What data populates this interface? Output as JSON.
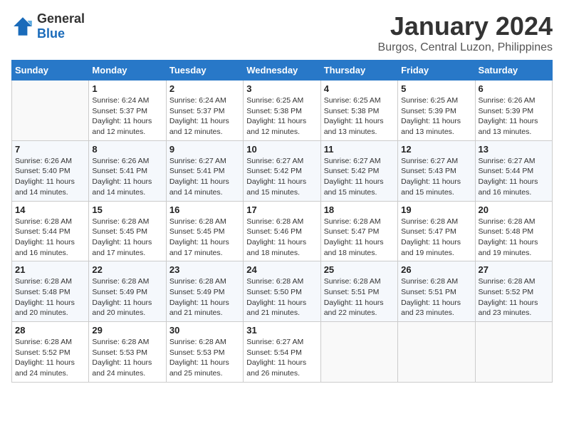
{
  "header": {
    "logo": {
      "general": "General",
      "blue": "Blue"
    },
    "title": "January 2024",
    "location": "Burgos, Central Luzon, Philippines"
  },
  "days_of_week": [
    "Sunday",
    "Monday",
    "Tuesday",
    "Wednesday",
    "Thursday",
    "Friday",
    "Saturday"
  ],
  "weeks": [
    [
      {
        "day": "",
        "info": ""
      },
      {
        "day": "1",
        "info": "Sunrise: 6:24 AM\nSunset: 5:37 PM\nDaylight: 11 hours\nand 12 minutes."
      },
      {
        "day": "2",
        "info": "Sunrise: 6:24 AM\nSunset: 5:37 PM\nDaylight: 11 hours\nand 12 minutes."
      },
      {
        "day": "3",
        "info": "Sunrise: 6:25 AM\nSunset: 5:38 PM\nDaylight: 11 hours\nand 12 minutes."
      },
      {
        "day": "4",
        "info": "Sunrise: 6:25 AM\nSunset: 5:38 PM\nDaylight: 11 hours\nand 13 minutes."
      },
      {
        "day": "5",
        "info": "Sunrise: 6:25 AM\nSunset: 5:39 PM\nDaylight: 11 hours\nand 13 minutes."
      },
      {
        "day": "6",
        "info": "Sunrise: 6:26 AM\nSunset: 5:39 PM\nDaylight: 11 hours\nand 13 minutes."
      }
    ],
    [
      {
        "day": "7",
        "info": "Sunrise: 6:26 AM\nSunset: 5:40 PM\nDaylight: 11 hours\nand 14 minutes."
      },
      {
        "day": "8",
        "info": "Sunrise: 6:26 AM\nSunset: 5:41 PM\nDaylight: 11 hours\nand 14 minutes."
      },
      {
        "day": "9",
        "info": "Sunrise: 6:27 AM\nSunset: 5:41 PM\nDaylight: 11 hours\nand 14 minutes."
      },
      {
        "day": "10",
        "info": "Sunrise: 6:27 AM\nSunset: 5:42 PM\nDaylight: 11 hours\nand 15 minutes."
      },
      {
        "day": "11",
        "info": "Sunrise: 6:27 AM\nSunset: 5:42 PM\nDaylight: 11 hours\nand 15 minutes."
      },
      {
        "day": "12",
        "info": "Sunrise: 6:27 AM\nSunset: 5:43 PM\nDaylight: 11 hours\nand 15 minutes."
      },
      {
        "day": "13",
        "info": "Sunrise: 6:27 AM\nSunset: 5:44 PM\nDaylight: 11 hours\nand 16 minutes."
      }
    ],
    [
      {
        "day": "14",
        "info": "Sunrise: 6:28 AM\nSunset: 5:44 PM\nDaylight: 11 hours\nand 16 minutes."
      },
      {
        "day": "15",
        "info": "Sunrise: 6:28 AM\nSunset: 5:45 PM\nDaylight: 11 hours\nand 17 minutes."
      },
      {
        "day": "16",
        "info": "Sunrise: 6:28 AM\nSunset: 5:45 PM\nDaylight: 11 hours\nand 17 minutes."
      },
      {
        "day": "17",
        "info": "Sunrise: 6:28 AM\nSunset: 5:46 PM\nDaylight: 11 hours\nand 18 minutes."
      },
      {
        "day": "18",
        "info": "Sunrise: 6:28 AM\nSunset: 5:47 PM\nDaylight: 11 hours\nand 18 minutes."
      },
      {
        "day": "19",
        "info": "Sunrise: 6:28 AM\nSunset: 5:47 PM\nDaylight: 11 hours\nand 19 minutes."
      },
      {
        "day": "20",
        "info": "Sunrise: 6:28 AM\nSunset: 5:48 PM\nDaylight: 11 hours\nand 19 minutes."
      }
    ],
    [
      {
        "day": "21",
        "info": "Sunrise: 6:28 AM\nSunset: 5:48 PM\nDaylight: 11 hours\nand 20 minutes."
      },
      {
        "day": "22",
        "info": "Sunrise: 6:28 AM\nSunset: 5:49 PM\nDaylight: 11 hours\nand 20 minutes."
      },
      {
        "day": "23",
        "info": "Sunrise: 6:28 AM\nSunset: 5:49 PM\nDaylight: 11 hours\nand 21 minutes."
      },
      {
        "day": "24",
        "info": "Sunrise: 6:28 AM\nSunset: 5:50 PM\nDaylight: 11 hours\nand 21 minutes."
      },
      {
        "day": "25",
        "info": "Sunrise: 6:28 AM\nSunset: 5:51 PM\nDaylight: 11 hours\nand 22 minutes."
      },
      {
        "day": "26",
        "info": "Sunrise: 6:28 AM\nSunset: 5:51 PM\nDaylight: 11 hours\nand 23 minutes."
      },
      {
        "day": "27",
        "info": "Sunrise: 6:28 AM\nSunset: 5:52 PM\nDaylight: 11 hours\nand 23 minutes."
      }
    ],
    [
      {
        "day": "28",
        "info": "Sunrise: 6:28 AM\nSunset: 5:52 PM\nDaylight: 11 hours\nand 24 minutes."
      },
      {
        "day": "29",
        "info": "Sunrise: 6:28 AM\nSunset: 5:53 PM\nDaylight: 11 hours\nand 24 minutes."
      },
      {
        "day": "30",
        "info": "Sunrise: 6:28 AM\nSunset: 5:53 PM\nDaylight: 11 hours\nand 25 minutes."
      },
      {
        "day": "31",
        "info": "Sunrise: 6:27 AM\nSunset: 5:54 PM\nDaylight: 11 hours\nand 26 minutes."
      },
      {
        "day": "",
        "info": ""
      },
      {
        "day": "",
        "info": ""
      },
      {
        "day": "",
        "info": ""
      }
    ]
  ]
}
